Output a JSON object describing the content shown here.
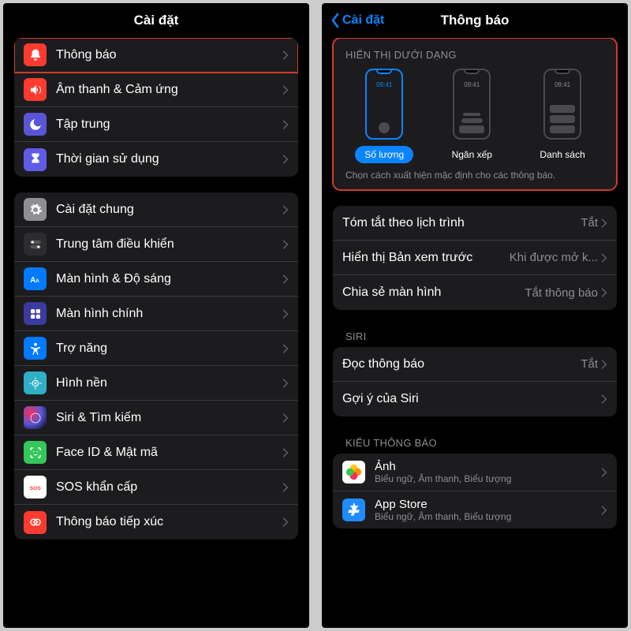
{
  "left": {
    "title": "Cài đặt",
    "group1": [
      {
        "label": "Thông báo",
        "icon": "bell-icon",
        "bg": "bg-red",
        "hl": true
      },
      {
        "label": "Âm thanh & Cảm ứng",
        "icon": "sound-icon",
        "bg": "bg-red"
      },
      {
        "label": "Tập trung",
        "icon": "moon-icon",
        "bg": "bg-purple"
      },
      {
        "label": "Thời gian sử dụng",
        "icon": "hourglass-icon",
        "bg": "bg-indigo"
      }
    ],
    "group2": [
      {
        "label": "Cài đặt chung",
        "icon": "gear-icon",
        "bg": "bg-gray"
      },
      {
        "label": "Trung tâm điều khiển",
        "icon": "switches-icon",
        "bg": "bg-darkgray"
      },
      {
        "label": "Màn hình & Độ sáng",
        "icon": "aa-icon",
        "bg": "bg-blue"
      },
      {
        "label": "Màn hình chính",
        "icon": "homeapps-icon",
        "bg": "bg-homeapps"
      },
      {
        "label": "Trợ năng",
        "icon": "accessibility-icon",
        "bg": "bg-blue"
      },
      {
        "label": "Hình nền",
        "icon": "wallpaper-icon",
        "bg": "bg-teal"
      },
      {
        "label": "Siri & Tìm kiếm",
        "icon": "siri-icon",
        "bg": "bg-siri"
      },
      {
        "label": "Face ID & Mật mã",
        "icon": "faceid-icon",
        "bg": "bg-green"
      },
      {
        "label": "SOS khẩn cấp",
        "icon": "sos-icon",
        "bg": "bg-sos"
      },
      {
        "label": "Thông báo tiếp xúc",
        "icon": "exposure-icon",
        "bg": "bg-red"
      }
    ]
  },
  "right": {
    "back": "Cài đặt",
    "title": "Thông báo",
    "display_as_title": "HIỂN THỊ DƯỚI DẠNG",
    "time_sample": "09:41",
    "options": [
      {
        "label": "Số lượng",
        "kind": "count",
        "selected": true
      },
      {
        "label": "Ngăn xếp",
        "kind": "stack",
        "selected": false
      },
      {
        "label": "Danh sách",
        "kind": "list",
        "selected": false
      }
    ],
    "display_footer": "Chọn cách xuất hiện mặc định cho các thông báo.",
    "rows1": [
      {
        "label": "Tóm tắt theo lịch trình",
        "value": "Tắt"
      },
      {
        "label": "Hiển thị Bản xem trước",
        "value": "Khi được mở k..."
      },
      {
        "label": "Chia sẻ màn hình",
        "value": "Tắt thông báo"
      }
    ],
    "siri_title": "SIRI",
    "rows2": [
      {
        "label": "Đọc thông báo",
        "value": "Tắt"
      },
      {
        "label": "Gợi ý của Siri",
        "value": ""
      }
    ],
    "style_title": "KIỂU THÔNG BÁO",
    "apps": [
      {
        "name": "Ảnh",
        "sub": "Biểu ngữ, Âm thanh, Biểu tượng",
        "icon": "photos-icon",
        "bg": "bg-photos"
      },
      {
        "name": "App Store",
        "sub": "Biểu ngữ, Âm thanh, Biểu tượng",
        "icon": "appstore-icon",
        "bg": "bg-appstore"
      }
    ]
  }
}
